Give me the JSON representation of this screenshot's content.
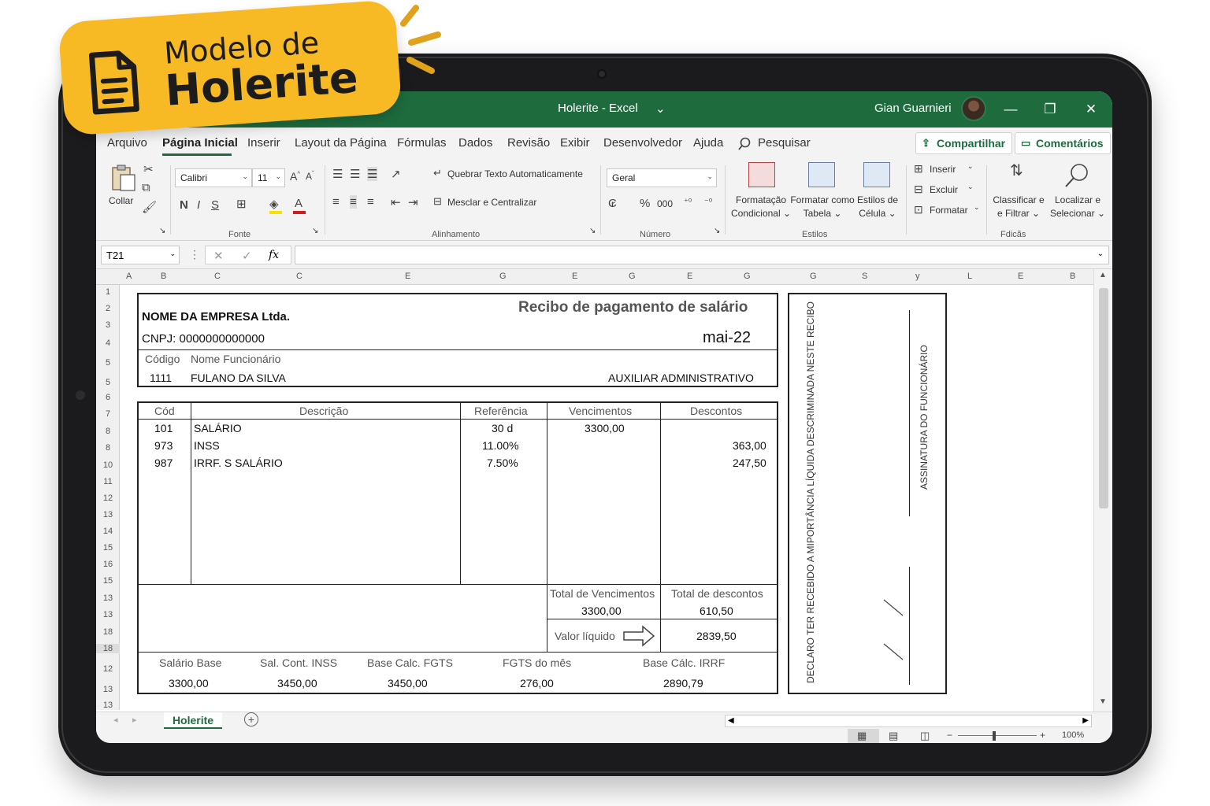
{
  "badge": {
    "line1": "Modelo de",
    "line2": "Holerite"
  },
  "titlebar": {
    "title": "Holerite  -  Excel",
    "dropdown": "⌄",
    "user": "Gian Guarnieri",
    "minimize": "—",
    "restore": "❐",
    "close": "✕"
  },
  "tabs": [
    "Arquivo",
    "Página Inicial",
    "Inserir",
    "Layout da Página",
    "Fórmulas",
    "Dados",
    "Revisão",
    "Exibir",
    "Desenvolvedor",
    "Ajuda"
  ],
  "search_label": "Pesquisar",
  "share_label": "Compartilhar",
  "comments_label": "Comentários",
  "ribbon": {
    "paste_label": "Collar",
    "font_name": "Calibri",
    "font_size": "11",
    "bold": "N",
    "italic": "I",
    "underline": "S",
    "wrap_text": "Quebrar Texto Automaticamente",
    "merge_center": "Mesclar e Centralizar",
    "number_format": "Geral",
    "percent": "%",
    "thousands": "000",
    "cond_format": [
      "Formatação",
      "Condicional ⌄"
    ],
    "format_table": [
      "Formatar como",
      "Tabela ⌄"
    ],
    "cell_styles": [
      "Estilos de",
      "Célula ⌄"
    ],
    "insert": "Inserir",
    "delete": "Excluir",
    "format": "Formatar",
    "sort_filter": [
      "Classificar e",
      "e Filtrar ⌄"
    ],
    "find_select": [
      "Localizar e",
      "Selecionar ⌄"
    ],
    "groups": {
      "clipboard": "",
      "font": "Fonte",
      "alignment": "Alinhamento",
      "number": "Número",
      "styles": "Estilos",
      "editing": "Fdicãs"
    }
  },
  "formula_bar": {
    "cell_ref": "T21",
    "cancel": "✕",
    "enter": "✓",
    "fx": "fx"
  },
  "columns": [
    "A",
    "B",
    "C",
    "C",
    "E",
    "G",
    "E",
    "G",
    "E",
    "G",
    "G",
    "S",
    "y",
    "L",
    "E",
    "B"
  ],
  "rows": [
    "1",
    "2",
    "3",
    "4",
    "5",
    "5",
    "6",
    "7",
    "8",
    "8",
    "10",
    "11",
    "12",
    "13",
    "14",
    "15",
    "16",
    "15",
    "13",
    "13",
    "18",
    "18",
    "12",
    "13",
    "13"
  ],
  "payslip": {
    "title": "Recibo de pagamento de salário",
    "company": "NOME DA EMPRESA Ltda.",
    "cnpj": "CNPJ: 0000000000000",
    "period": "mai-22",
    "code_label": "Código",
    "name_label": "Nome Funcionário",
    "employee_code": "1111",
    "employee_name": "FULANO DA SILVA",
    "role": "AUXILIAR ADMINISTRATIVO",
    "headers": {
      "code": "Cód",
      "description": "Descrição",
      "reference": "Referência",
      "earnings": "Vencimentos",
      "deductions": "Descontos"
    },
    "items": [
      {
        "code": "101",
        "description": "SALÁRIO",
        "reference": "30 d",
        "earnings": "3300,00",
        "deductions": ""
      },
      {
        "code": "973",
        "description": "INSS",
        "reference": "11.00%",
        "earnings": "",
        "deductions": "363,00"
      },
      {
        "code": "987",
        "description": "IRRF. S SALÁRIO",
        "reference": "7.50%",
        "earnings": "",
        "deductions": "247,50"
      }
    ],
    "total_earnings_label": "Total de Vencimentos",
    "total_earnings": "3300,00",
    "total_deductions_label": "Total de descontos",
    "total_deductions": "610,50",
    "net_label": "Valor líquido",
    "net_value": "2839,50",
    "footer": [
      {
        "label": "Salário Base",
        "value": "3300,00"
      },
      {
        "label": "Sal. Cont. INSS",
        "value": "3450,00"
      },
      {
        "label": "Base Calc. FGTS",
        "value": "3450,00"
      },
      {
        "label": "FGTS do mês",
        "value": "276,00"
      },
      {
        "label": "Base Cálc. IRRF",
        "value": "2890,79"
      }
    ],
    "declaration": "DECLARO TER RECEBIDO A MIPORTÂNCIA LÍQUIDA DESCRIMINADA NESTE RECIBO",
    "signature_label": "ASSINATURA DO FUNCIONÁRIO"
  },
  "sheet_tab": "Holerite",
  "add_sheet": "+",
  "zoom": "100%"
}
